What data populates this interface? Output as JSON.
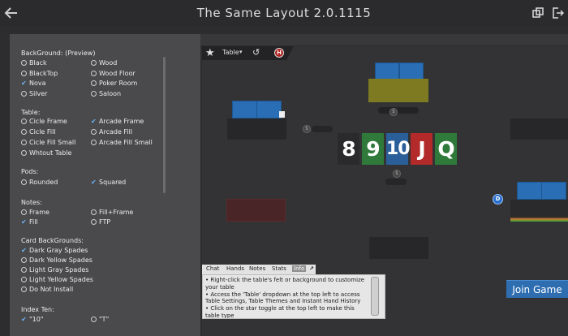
{
  "title": "The Same Layout 2.0.1115",
  "toolbar": {
    "table_label": "Table",
    "table_arrow": "▾",
    "star_glyph": "★",
    "undo_glyph": "↺",
    "history_badge": "H"
  },
  "settings": {
    "background": {
      "heading": "BackGround: (Preview)",
      "options": [
        {
          "label": "Black",
          "checked": false
        },
        {
          "label": "Wood",
          "checked": false
        },
        {
          "label": "BlackTop",
          "checked": false
        },
        {
          "label": "Wood Floor",
          "checked": false
        },
        {
          "label": "Nova",
          "checked": true
        },
        {
          "label": "Poker Room",
          "checked": false
        },
        {
          "label": "Silver",
          "checked": false
        },
        {
          "label": "Saloon",
          "checked": false
        }
      ]
    },
    "table": {
      "heading": "Table:",
      "options": [
        {
          "label": "Cicle Frame",
          "checked": false
        },
        {
          "label": "Arcade Frame",
          "checked": true
        },
        {
          "label": "Cicle Fill",
          "checked": false
        },
        {
          "label": "Arcade Fill",
          "checked": false
        },
        {
          "label": "Cicle Fill Small",
          "checked": false
        },
        {
          "label": "Arcade Fill Small",
          "checked": false
        },
        {
          "label": "Whtout Table",
          "checked": false
        }
      ]
    },
    "pods": {
      "heading": "Pods:",
      "options": [
        {
          "label": "Rounded",
          "checked": false
        },
        {
          "label": "Squared",
          "checked": true
        }
      ]
    },
    "notes": {
      "heading": "Notes:",
      "options": [
        {
          "label": "Frame",
          "checked": false
        },
        {
          "label": "Fill+Frame",
          "checked": false
        },
        {
          "label": "Fill",
          "checked": true
        },
        {
          "label": "FTP",
          "checked": false
        }
      ]
    },
    "card_backgrounds": {
      "heading": "Card BackGrounds:",
      "options": [
        {
          "label": "Dark Gray Spades",
          "checked": true
        },
        {
          "label": "Dark Yellow Spades",
          "checked": false
        },
        {
          "label": "Light Gray Spades",
          "checked": false
        },
        {
          "label": "Light Yellow Spades",
          "checked": false
        },
        {
          "label": "Do Not Install",
          "checked": false
        }
      ]
    },
    "index_ten": {
      "heading": "Index Ten:",
      "options": [
        {
          "label": "\"10\"",
          "checked": true
        },
        {
          "label": "\"T\"",
          "checked": false
        }
      ]
    }
  },
  "board": {
    "cards": [
      {
        "rank": "8",
        "color": "#2a2a2c"
      },
      {
        "rank": "9",
        "color": "#2f7a3a"
      },
      {
        "rank": "10",
        "color": "#2b5f9a"
      },
      {
        "rank": "J",
        "color": "#b32a2a"
      },
      {
        "rank": "Q",
        "color": "#2f7a3a"
      }
    ]
  },
  "dealer_badge": "D",
  "seat_chip": "$",
  "info": {
    "tabs": [
      "Chat",
      "Hands",
      "Notes",
      "Stats",
      "Info"
    ],
    "active_tab": "Info",
    "popout_glyph": "↗",
    "lines": [
      "• Right-click the table's felt or background to customize your table",
      "• Access the 'Table' dropdown at the top left to access Table Settings, Table Themes and Instant Hand History",
      "• Click on the star toggle at the top left to make this table type"
    ]
  },
  "join_button": "Join Game",
  "colors": {
    "accent": "#2d6db0",
    "background": "#2d2d2f",
    "panel": "#4a4a4c",
    "card_back": "#2a6fb6",
    "olive_card": "#7d7a22"
  }
}
